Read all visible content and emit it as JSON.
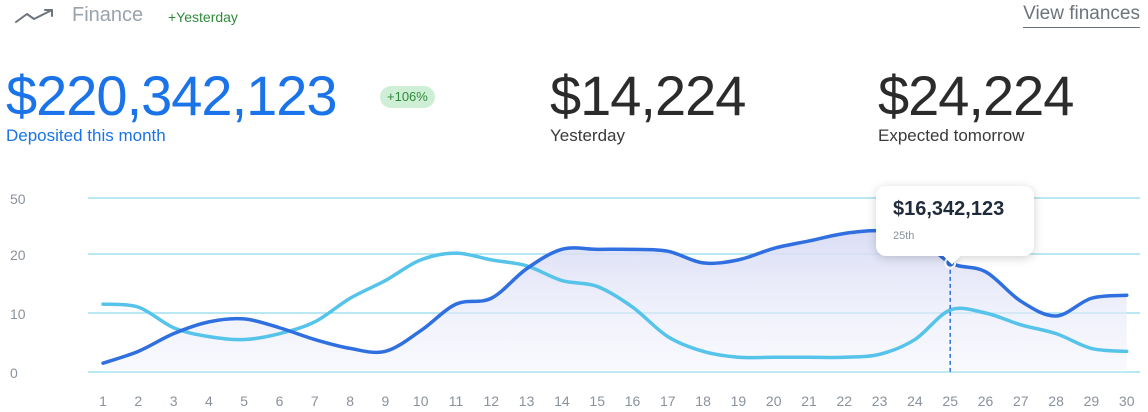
{
  "header": {
    "title": "Finance",
    "delta": "+Yesterday",
    "view_link": "View finances"
  },
  "stats": {
    "main": {
      "value": "$220,342,123",
      "label": "Deposited this month",
      "badge": "+106%"
    },
    "yesterday": {
      "value": "$14,224",
      "label": "Yesterday"
    },
    "tomorrow": {
      "value": "$24,224",
      "label": "Expected tomorrow"
    }
  },
  "tooltip": {
    "value": "$16,342,123",
    "date": "25th"
  },
  "colors": {
    "dark_line": "#2f6fe0",
    "light_line": "#56c3ea",
    "grid": "#8fd9ec",
    "accent": "#1a73e8"
  },
  "chart_data": {
    "type": "line",
    "x": [
      1,
      2,
      3,
      4,
      5,
      6,
      7,
      8,
      9,
      10,
      11,
      12,
      13,
      14,
      15,
      16,
      17,
      18,
      19,
      20,
      21,
      22,
      23,
      24,
      25,
      26,
      27,
      28,
      29,
      30
    ],
    "y_ticks": [
      "0",
      "10",
      "20",
      "50"
    ],
    "series": [
      {
        "values": [
          1.5,
          3.5,
          6.5,
          8.5,
          9,
          7.5,
          5.5,
          4,
          3.5,
          7,
          11.5,
          12.5,
          17.5,
          22.5,
          22.5,
          22.5,
          21.5,
          18.5,
          19,
          23,
          27,
          31,
          32.5,
          30,
          18.5,
          17,
          12,
          9.5,
          12.5,
          13
        ]
      },
      {
        "values": [
          11.5,
          11,
          7.5,
          6,
          5.5,
          6.5,
          8.5,
          12.5,
          15.5,
          19,
          20.5,
          19,
          18,
          15.5,
          14.5,
          11,
          6,
          3.5,
          2.5,
          2.5,
          2.5,
          2.5,
          3,
          5.5,
          10.5,
          10,
          8,
          6.5,
          4,
          3.5
        ]
      }
    ],
    "highlight": {
      "x": 25,
      "series": 0
    }
  }
}
